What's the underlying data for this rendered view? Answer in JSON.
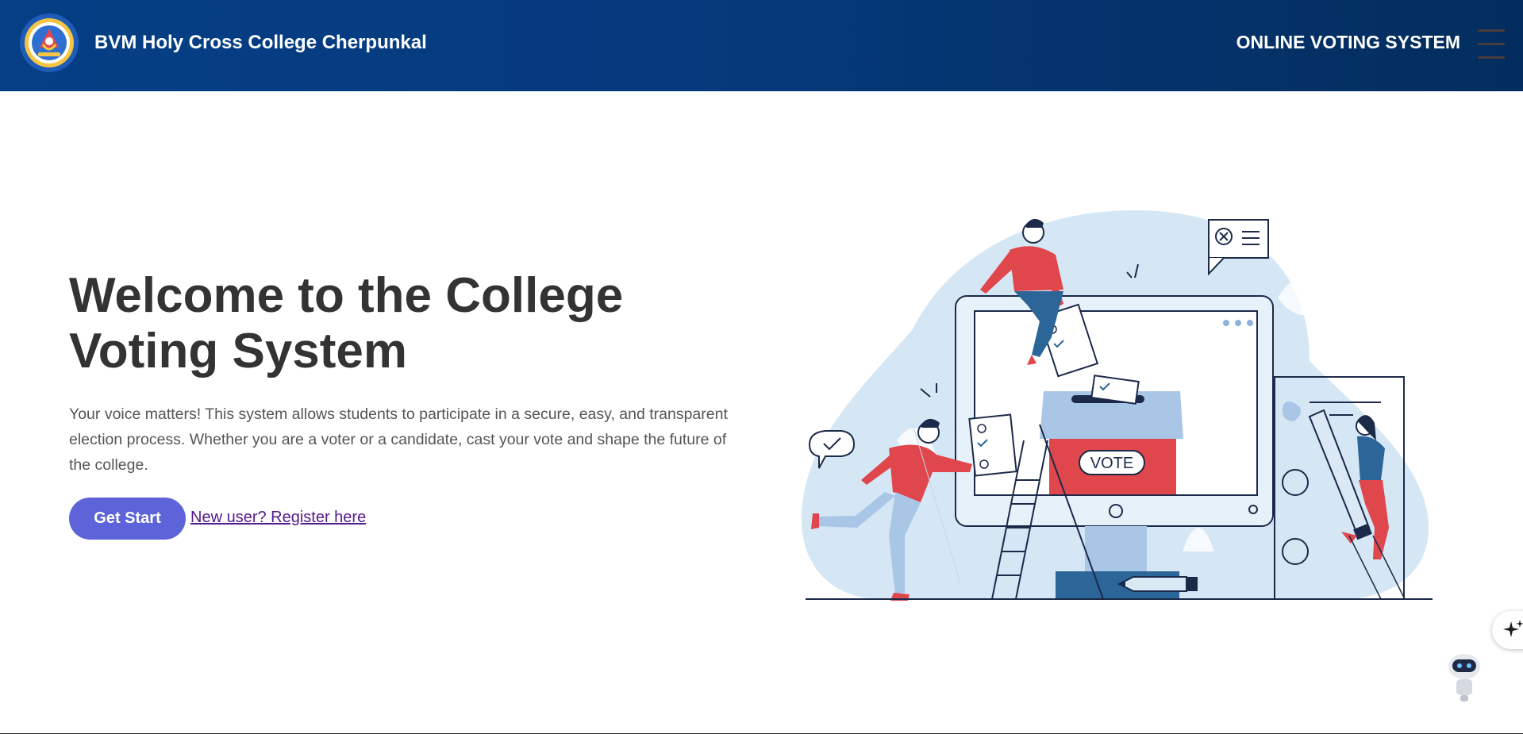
{
  "header": {
    "brand": "BVM Holy Cross College Cherpunkal",
    "title": "ONLINE VOTING SYSTEM",
    "logo_icon": "college-seal",
    "menu_icon": "hamburger-icon",
    "colors": {
      "navbar_start": "#063f86",
      "navbar_end": "#032d5e"
    }
  },
  "hero": {
    "title": "Welcome to the College Voting System",
    "description": "Your voice matters! This system allows students to participate in a secure, easy, and transparent election process. Whether you are a voter or a candidate, cast your vote and shape the future of the college.",
    "primary_button": "Get Start",
    "register_link": "New user? Register here",
    "illustration_label": "VOTE",
    "colors": {
      "button": "#5d63d8",
      "link": "#551a8b",
      "accent_red": "#e0474c"
    }
  },
  "widgets": {
    "sparkle_icon": "sparkle-icon",
    "chatbot_icon": "robot-icon"
  }
}
